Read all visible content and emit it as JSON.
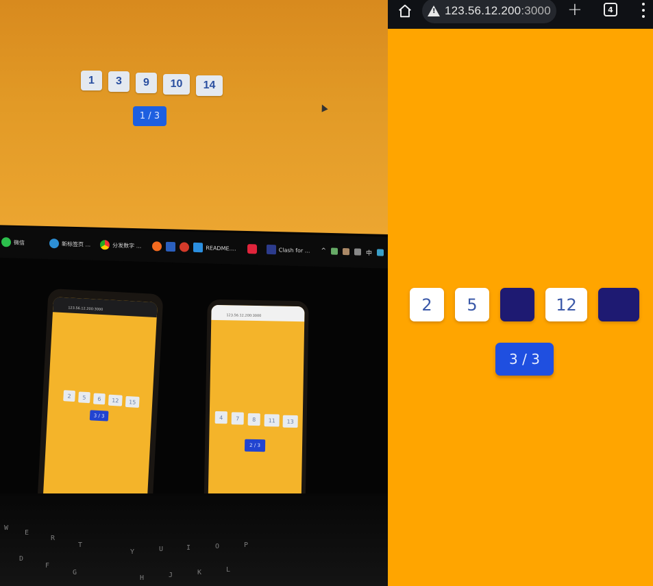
{
  "desktop": {
    "tiles": [
      "1",
      "3",
      "9",
      "10",
      "14"
    ],
    "pager": "1 / 3",
    "taskbar": {
      "items": [
        "微信",
        "新标签页 ...",
        "分发数字 ...",
        "README....",
        "Clash for ..."
      ],
      "tray_ime": "中"
    }
  },
  "phone_left": {
    "url": "123.56.12.200:3000",
    "tiles": [
      "2",
      "5",
      "6",
      "12",
      "15"
    ],
    "pager": "3 / 3"
  },
  "phone_right": {
    "url": "123.56.12.200:3000",
    "tiles": [
      "4",
      "7",
      "8",
      "11",
      "13"
    ],
    "pager": "2 / 3"
  },
  "keyboard_keys": [
    "W",
    "E",
    "R",
    "T",
    "Y",
    "U",
    "I",
    "O",
    "P",
    "D",
    "F",
    "G",
    "H",
    "J",
    "K",
    "L"
  ],
  "browser": {
    "url_host": "123.56.12.200",
    "url_port": ":3000",
    "tab_count": "4",
    "tiles": [
      {
        "label": "2",
        "state": "revealed"
      },
      {
        "label": "5",
        "state": "revealed"
      },
      {
        "label": "",
        "state": "hidden"
      },
      {
        "label": "12",
        "state": "revealed"
      },
      {
        "label": "",
        "state": "hidden"
      }
    ],
    "pager": "3 / 3",
    "colors": {
      "background": "#ffa500",
      "tile_revealed": "#ffffff",
      "tile_hidden": "#1e1a72",
      "pager": "#1f4fe0",
      "toolbar": "#0f1115"
    }
  }
}
